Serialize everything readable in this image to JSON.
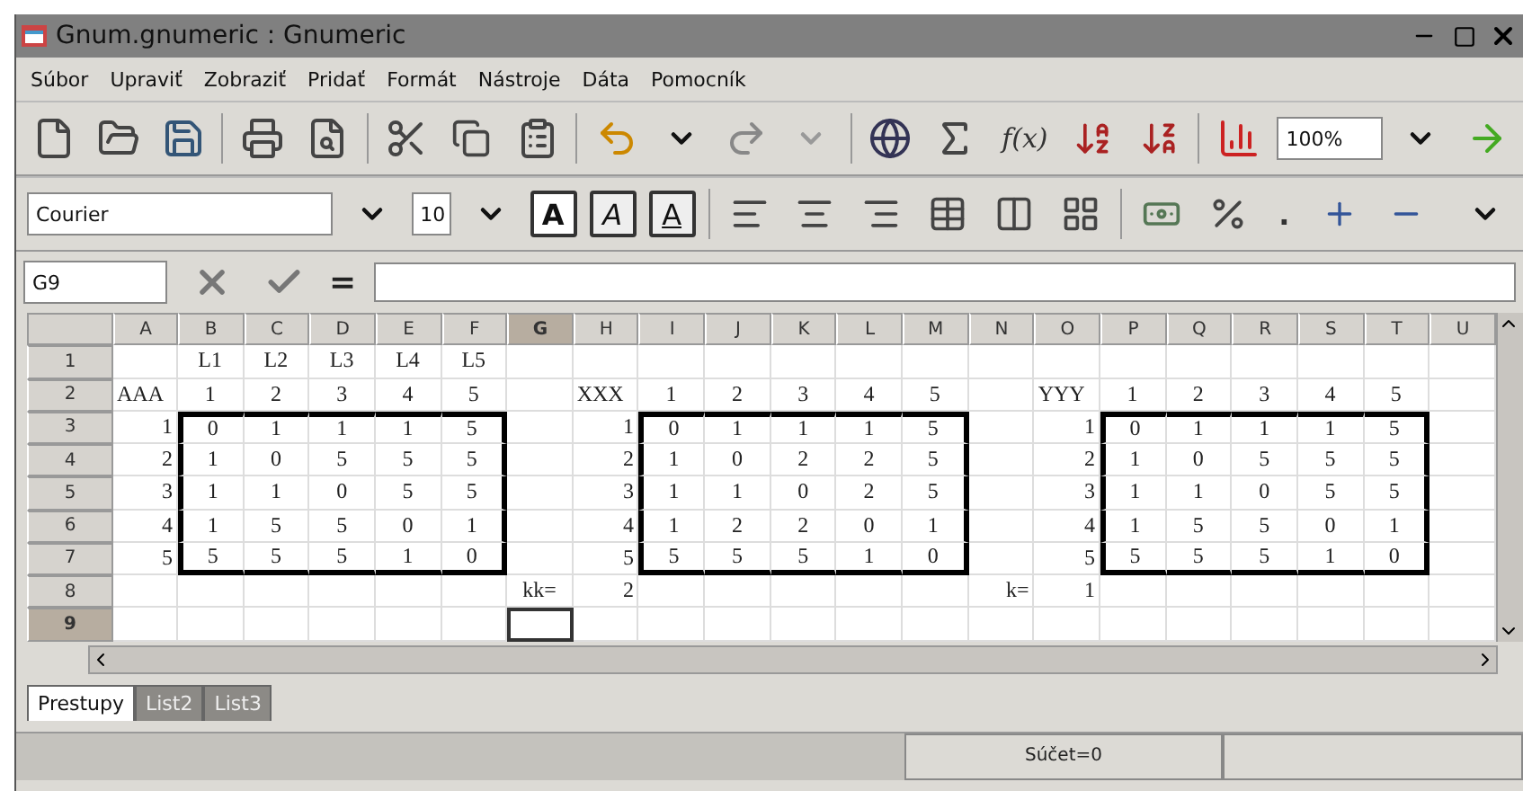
{
  "window": {
    "title": "Gnum.gnumeric : Gnumeric"
  },
  "menu": [
    "Súbor",
    "Upraviť",
    "Zobraziť",
    "Pridať",
    "Formát",
    "Nástroje",
    "Dáta",
    "Pomocník"
  ],
  "toolbar": {
    "function_label": "f(x)",
    "zoom": "100%"
  },
  "format_bar": {
    "font": "Courier",
    "size": "10",
    "bold": "A",
    "italic": "A",
    "underline": "A",
    "thousands": "."
  },
  "formula_bar": {
    "cell_ref": "G9",
    "equals": "="
  },
  "sheet": {
    "columns": [
      {
        "label": "A",
        "selected": false
      },
      {
        "label": "B",
        "selected": false
      },
      {
        "label": "C",
        "selected": false
      },
      {
        "label": "D",
        "selected": false
      },
      {
        "label": "E",
        "selected": false
      },
      {
        "label": "F",
        "selected": false
      },
      {
        "label": "G",
        "selected": true
      },
      {
        "label": "H",
        "selected": false
      },
      {
        "label": "I",
        "selected": false
      },
      {
        "label": "J",
        "selected": false
      },
      {
        "label": "K",
        "selected": false
      },
      {
        "label": "L",
        "selected": false
      },
      {
        "label": "M",
        "selected": false
      },
      {
        "label": "N",
        "selected": false
      },
      {
        "label": "O",
        "selected": false
      },
      {
        "label": "P",
        "selected": false
      },
      {
        "label": "Q",
        "selected": false
      },
      {
        "label": "R",
        "selected": false
      },
      {
        "label": "S",
        "selected": false
      },
      {
        "label": "T",
        "selected": false
      },
      {
        "label": "U",
        "selected": false
      }
    ],
    "rows": [
      {
        "label": "1",
        "selected": false,
        "cells": [
          null,
          "L1",
          "L2",
          "L3",
          "L4",
          "L5",
          null,
          null,
          null,
          null,
          null,
          null,
          null,
          null,
          null,
          null,
          null,
          null,
          null,
          null,
          null
        ]
      },
      {
        "label": "2",
        "selected": false,
        "cells": [
          {
            "text": "AAA",
            "flush_left": true
          },
          "1",
          "2",
          "3",
          "4",
          "5",
          null,
          {
            "text": "XXX",
            "flush_left": true
          },
          "1",
          "2",
          "3",
          "4",
          "5",
          null,
          {
            "text": "YYY",
            "flush_left": true
          },
          "1",
          "2",
          "3",
          "4",
          "5",
          null
        ]
      },
      {
        "label": "3",
        "selected": false,
        "cells": [
          {
            "text": "1",
            "flush_right": true
          },
          {
            "text": "0",
            "top": true,
            "left": true
          },
          {
            "text": "1",
            "top": true
          },
          {
            "text": "1",
            "top": true
          },
          {
            "text": "1",
            "top": true
          },
          {
            "text": "5",
            "top": true,
            "right": true
          },
          null,
          {
            "text": "1",
            "flush_right": true
          },
          {
            "text": "0",
            "top": true,
            "left": true
          },
          {
            "text": "1",
            "top": true
          },
          {
            "text": "1",
            "top": true
          },
          {
            "text": "1",
            "top": true
          },
          {
            "text": "5",
            "top": true,
            "right": true
          },
          null,
          {
            "text": "1",
            "flush_right": true
          },
          {
            "text": "0",
            "top": true,
            "left": true
          },
          {
            "text": "1",
            "top": true
          },
          {
            "text": "1",
            "top": true
          },
          {
            "text": "1",
            "top": true
          },
          {
            "text": "5",
            "top": true,
            "right": true
          },
          null
        ]
      },
      {
        "label": "4",
        "selected": false,
        "cells": [
          {
            "text": "2",
            "flush_right": true
          },
          {
            "text": "1",
            "left": true
          },
          "0",
          "5",
          "5",
          {
            "text": "5",
            "right": true
          },
          null,
          {
            "text": "2",
            "flush_right": true
          },
          {
            "text": "1",
            "left": true
          },
          "0",
          "2",
          "2",
          {
            "text": "5",
            "right": true
          },
          null,
          {
            "text": "2",
            "flush_right": true
          },
          {
            "text": "1",
            "left": true
          },
          "0",
          "5",
          "5",
          {
            "text": "5",
            "right": true
          },
          null
        ]
      },
      {
        "label": "5",
        "selected": false,
        "cells": [
          {
            "text": "3",
            "flush_right": true
          },
          {
            "text": "1",
            "left": true
          },
          "1",
          "0",
          "5",
          {
            "text": "5",
            "right": true
          },
          null,
          {
            "text": "3",
            "flush_right": true
          },
          {
            "text": "1",
            "left": true
          },
          "1",
          "0",
          "2",
          {
            "text": "5",
            "right": true
          },
          null,
          {
            "text": "3",
            "flush_right": true
          },
          {
            "text": "1",
            "left": true
          },
          "1",
          "0",
          "5",
          {
            "text": "5",
            "right": true
          },
          null
        ]
      },
      {
        "label": "6",
        "selected": false,
        "cells": [
          {
            "text": "4",
            "flush_right": true
          },
          {
            "text": "1",
            "left": true
          },
          "5",
          "5",
          "0",
          {
            "text": "1",
            "right": true
          },
          null,
          {
            "text": "4",
            "flush_right": true
          },
          {
            "text": "1",
            "left": true
          },
          "2",
          "2",
          "0",
          {
            "text": "1",
            "right": true
          },
          null,
          {
            "text": "4",
            "flush_right": true
          },
          {
            "text": "1",
            "left": true
          },
          "5",
          "5",
          "0",
          {
            "text": "1",
            "right": true
          },
          null
        ]
      },
      {
        "label": "7",
        "selected": false,
        "cells": [
          {
            "text": "5",
            "flush_right": true
          },
          {
            "text": "5",
            "bottom": true,
            "left": true
          },
          {
            "text": "5",
            "bottom": true
          },
          {
            "text": "5",
            "bottom": true
          },
          {
            "text": "1",
            "bottom": true
          },
          {
            "text": "0",
            "bottom": true,
            "right": true
          },
          null,
          {
            "text": "5",
            "flush_right": true
          },
          {
            "text": "5",
            "bottom": true,
            "left": true
          },
          {
            "text": "5",
            "bottom": true
          },
          {
            "text": "5",
            "bottom": true
          },
          {
            "text": "1",
            "bottom": true
          },
          {
            "text": "0",
            "bottom": true,
            "right": true
          },
          null,
          {
            "text": "5",
            "flush_right": true
          },
          {
            "text": "5",
            "bottom": true,
            "left": true
          },
          {
            "text": "5",
            "bottom": true
          },
          {
            "text": "5",
            "bottom": true
          },
          {
            "text": "1",
            "bottom": true
          },
          {
            "text": "0",
            "bottom": true,
            "right": true
          },
          null
        ]
      },
      {
        "label": "8",
        "selected": false,
        "cells": [
          null,
          null,
          null,
          null,
          null,
          null,
          "kk=",
          {
            "text": "2",
            "flush_right": true
          },
          null,
          null,
          null,
          null,
          null,
          {
            "text": "k=",
            "flush_right": true
          },
          {
            "text": "1",
            "flush_right": true
          },
          null,
          null,
          null,
          null,
          null,
          null
        ]
      },
      {
        "label": "9",
        "selected": true,
        "cells": [
          null,
          null,
          null,
          null,
          null,
          null,
          null,
          null,
          null,
          null,
          null,
          null,
          null,
          null,
          null,
          null,
          null,
          null,
          null,
          null,
          null
        ]
      }
    ]
  },
  "sheet_tabs": [
    {
      "label": "Prestupy",
      "selected": true
    },
    {
      "label": "List2",
      "selected": false
    },
    {
      "label": "List3",
      "selected": false
    }
  ],
  "status_bar": {
    "sum": "Súčet=0"
  }
}
